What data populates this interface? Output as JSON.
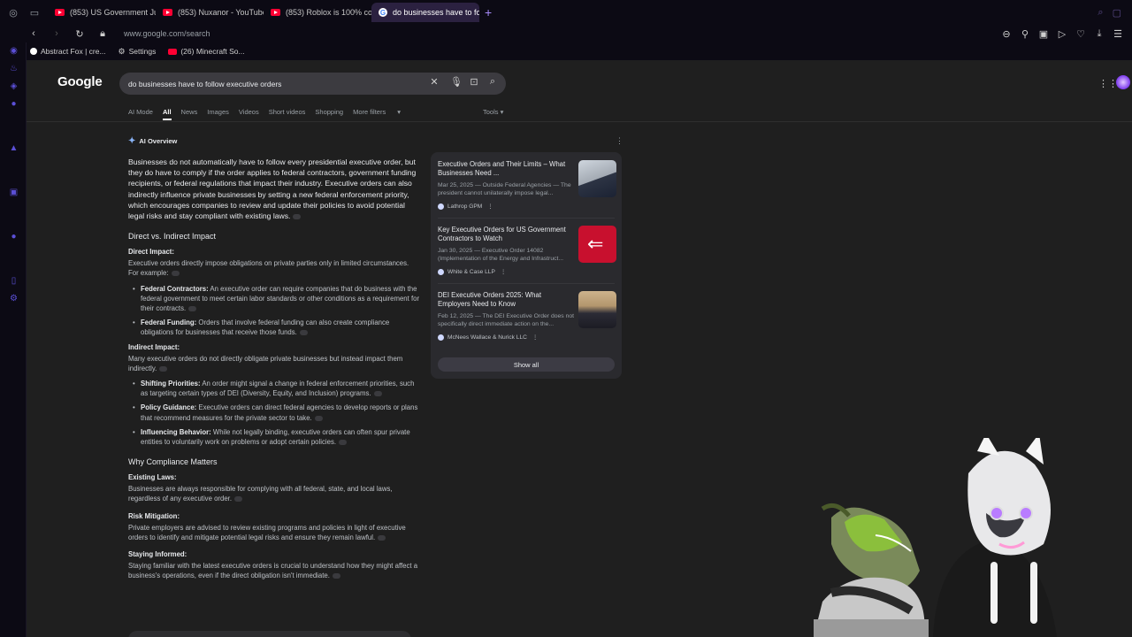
{
  "tabs": [
    {
      "label": "(853) US Government Ju",
      "type": "youtube"
    },
    {
      "label": "(853) Nuxanor - YouTube",
      "type": "youtube"
    },
    {
      "label": "(853) Roblox is 100% coo",
      "type": "youtube"
    },
    {
      "label": "do businesses have to fo",
      "type": "google",
      "active": true
    }
  ],
  "address": {
    "url": "www.google.com/search"
  },
  "bookmarks": [
    {
      "label": "Abstract Fox | cre..."
    },
    {
      "label": "Settings"
    },
    {
      "label": "(26) Minecraft So..."
    }
  ],
  "search": {
    "logo": "Google",
    "query": "do businesses have to follow executive orders"
  },
  "filters": [
    "AI Mode",
    "All",
    "News",
    "Images",
    "Videos",
    "Short videos",
    "Shopping",
    "More filters"
  ],
  "tools_label": "Tools",
  "ai_overview": {
    "label": "AI Overview",
    "lead": "Businesses do not automatically have to follow every presidential executive order, but they do have to comply if the order applies to federal contractors, government funding recipients, or federal regulations that impact their industry. Executive orders can also indirectly influence private businesses by setting a new federal enforcement priority, which encourages companies to review and update their policies to avoid potential legal risks and stay compliant with existing laws.",
    "section1_title": "Direct vs. Indirect Impact",
    "direct_title": "Direct Impact:",
    "direct_text": "Executive orders directly impose obligations on private parties only in limited circumstances. For example:",
    "direct_items": [
      {
        "bold": "Federal Contractors:",
        "text": " An executive order can require companies that do business with the federal government to meet certain labor standards or other conditions as a requirement for their contracts."
      },
      {
        "bold": "Federal Funding:",
        "text": " Orders that involve federal funding can also create compliance obligations for businesses that receive those funds."
      }
    ],
    "indirect_title": "Indirect Impact:",
    "indirect_text": "Many executive orders do not directly obligate private businesses but instead impact them indirectly.",
    "indirect_items": [
      {
        "bold": "Shifting Priorities:",
        "text": " An order might signal a change in federal enforcement priorities, such as targeting certain types of DEI (Diversity, Equity, and Inclusion) programs."
      },
      {
        "bold": "Policy Guidance:",
        "text": " Executive orders can direct federal agencies to develop reports or plans that recommend measures for the private sector to take."
      },
      {
        "bold": "Influencing Behavior:",
        "text": " While not legally binding, executive orders can often spur private entities to voluntarily work on problems or adopt certain policies."
      }
    ],
    "section2_title": "Why Compliance Matters",
    "existing_title": "Existing Laws:",
    "existing_text": "Businesses are always responsible for complying with all federal, state, and local laws, regardless of any executive order.",
    "risk_title": "Risk Mitigation:",
    "risk_text": "Private employers are advised to review existing programs and policies in light of executive orders to identify and mitigate potential legal risks and ensure they remain lawful.",
    "staying_title": "Staying Informed:",
    "staying_text": "Staying familiar with the latest executive orders is crucial to understand how they might affect a business's operations, even if the direct obligation isn't immediate."
  },
  "sources": [
    {
      "title": "Executive Orders and Their Limits – What Businesses Need ...",
      "snippet": "Mar 25, 2025 — Outside Federal Agencies — The president cannot unilaterally impose legal...",
      "source": "Lathrop GPM"
    },
    {
      "title": "Key Executive Orders for US Government Contractors to Watch",
      "snippet": "Jan 30, 2025 — Executive Order 14082 (Implementation of the Energy and Infrastruct...",
      "source": "White & Case LLP"
    },
    {
      "title": "DEI Executive Orders 2025: What Employers Need to Know",
      "snippet": "Feb 12, 2025 — The DEI Executive Order does not specifically direct immediate action on the...",
      "source": "McNees Wallace & Nurick LLC"
    }
  ],
  "show_all_label": "Show all",
  "colors": {
    "accent": "#8ab4f8",
    "tab_active": "#2b2140",
    "sidebar_icon": "#5b4fd6"
  }
}
